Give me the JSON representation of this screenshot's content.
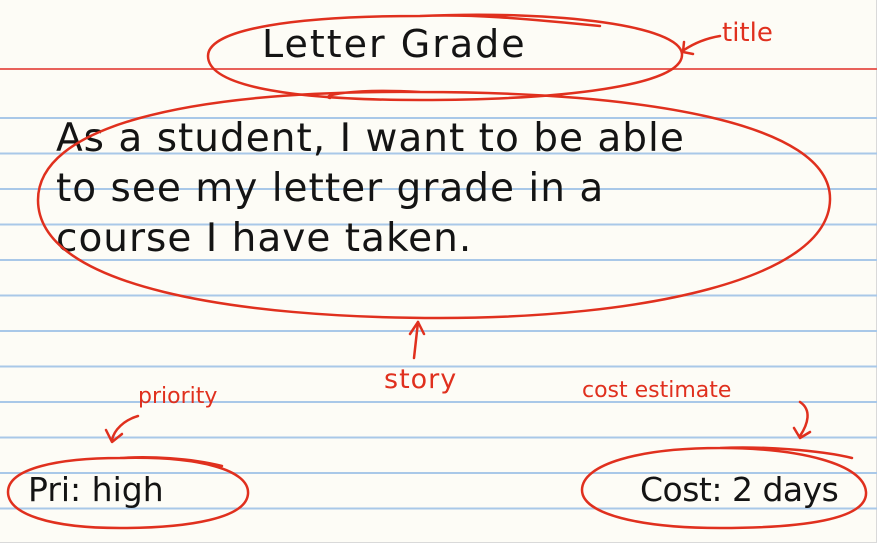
{
  "card": {
    "title": "Letter Grade",
    "story_lines": [
      "As a student, I want to be able",
      "to see my letter grade in a",
      "course I have taken."
    ],
    "priority": "Pri: high",
    "cost": "Cost: 2 days"
  },
  "annotations": {
    "title": "title",
    "story": "story",
    "priority": "priority",
    "cost": "cost estimate"
  },
  "colors": {
    "card": "#fdfcf6",
    "red_rule": "#e8615a",
    "blue_rule": "#a9c8e8",
    "ink": "#141414",
    "annotation": "#e0301e"
  }
}
